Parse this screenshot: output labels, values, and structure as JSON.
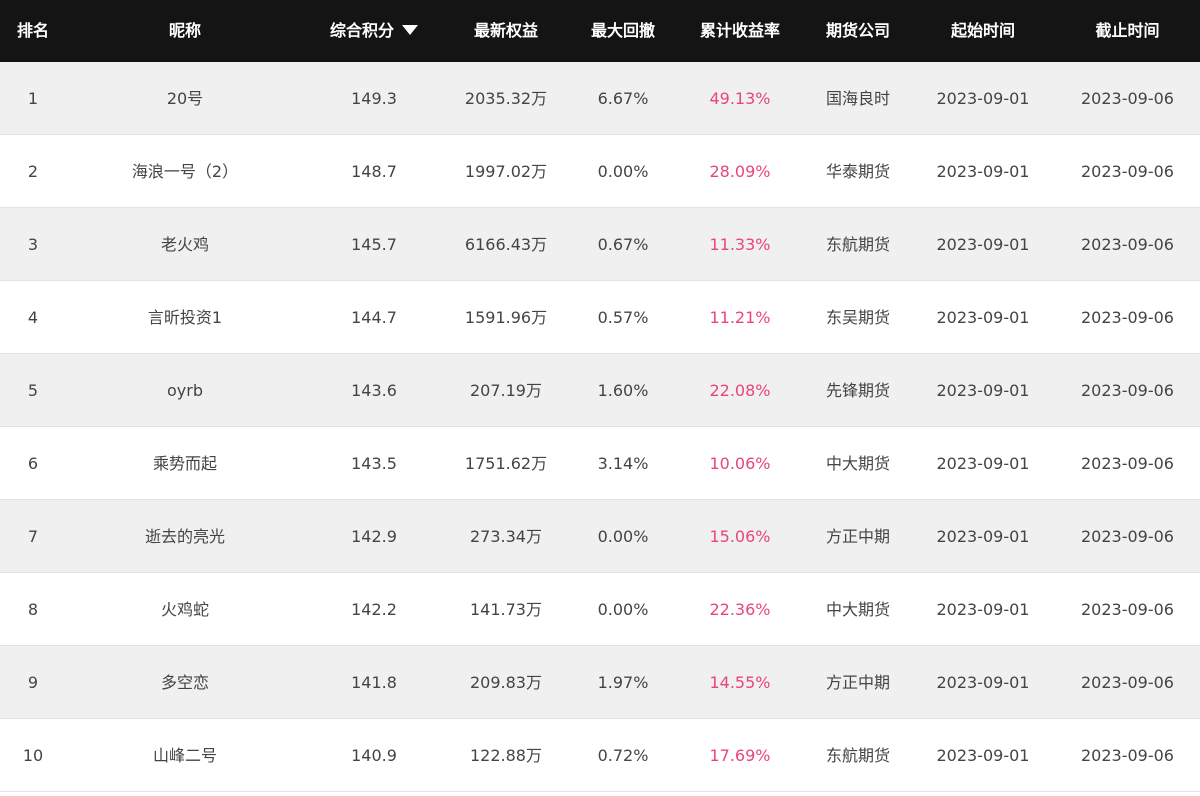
{
  "table": {
    "headers": {
      "rank": "排名",
      "nickname": "昵称",
      "score": "综合积分",
      "equity": "最新权益",
      "max_drawdown": "最大回撤",
      "cumulative_return": "累计收益率",
      "company": "期货公司",
      "start_time": "起始时间",
      "end_time": "截止时间"
    },
    "sort_icon": "caret-down-icon",
    "accent_color": "#e8457c",
    "header_bg": "#141414",
    "rows": [
      {
        "rank": "1",
        "nickname": "20号",
        "score": "149.3",
        "equity": "2035.32万",
        "max_drawdown": "6.67%",
        "cumulative_return": "49.13%",
        "company": "国海良时",
        "start_time": "2023-09-01",
        "end_time": "2023-09-06"
      },
      {
        "rank": "2",
        "nickname": "海浪一号（2）",
        "score": "148.7",
        "equity": "1997.02万",
        "max_drawdown": "0.00%",
        "cumulative_return": "28.09%",
        "company": "华泰期货",
        "start_time": "2023-09-01",
        "end_time": "2023-09-06"
      },
      {
        "rank": "3",
        "nickname": "老火鸡",
        "score": "145.7",
        "equity": "6166.43万",
        "max_drawdown": "0.67%",
        "cumulative_return": "11.33%",
        "company": "东航期货",
        "start_time": "2023-09-01",
        "end_time": "2023-09-06"
      },
      {
        "rank": "4",
        "nickname": "言昕投资1",
        "score": "144.7",
        "equity": "1591.96万",
        "max_drawdown": "0.57%",
        "cumulative_return": "11.21%",
        "company": "东吴期货",
        "start_time": "2023-09-01",
        "end_time": "2023-09-06"
      },
      {
        "rank": "5",
        "nickname": "oyrb",
        "score": "143.6",
        "equity": "207.19万",
        "max_drawdown": "1.60%",
        "cumulative_return": "22.08%",
        "company": "先锋期货",
        "start_time": "2023-09-01",
        "end_time": "2023-09-06"
      },
      {
        "rank": "6",
        "nickname": "乘势而起",
        "score": "143.5",
        "equity": "1751.62万",
        "max_drawdown": "3.14%",
        "cumulative_return": "10.06%",
        "company": "中大期货",
        "start_time": "2023-09-01",
        "end_time": "2023-09-06"
      },
      {
        "rank": "7",
        "nickname": "逝去的亮光",
        "score": "142.9",
        "equity": "273.34万",
        "max_drawdown": "0.00%",
        "cumulative_return": "15.06%",
        "company": "方正中期",
        "start_time": "2023-09-01",
        "end_time": "2023-09-06"
      },
      {
        "rank": "8",
        "nickname": "火鸡蛇",
        "score": "142.2",
        "equity": "141.73万",
        "max_drawdown": "0.00%",
        "cumulative_return": "22.36%",
        "company": "中大期货",
        "start_time": "2023-09-01",
        "end_time": "2023-09-06"
      },
      {
        "rank": "9",
        "nickname": "多空恋",
        "score": "141.8",
        "equity": "209.83万",
        "max_drawdown": "1.97%",
        "cumulative_return": "14.55%",
        "company": "方正中期",
        "start_time": "2023-09-01",
        "end_time": "2023-09-06"
      },
      {
        "rank": "10",
        "nickname": "山峰二号",
        "score": "140.9",
        "equity": "122.88万",
        "max_drawdown": "0.72%",
        "cumulative_return": "17.69%",
        "company": "东航期货",
        "start_time": "2023-09-01",
        "end_time": "2023-09-06"
      }
    ]
  }
}
